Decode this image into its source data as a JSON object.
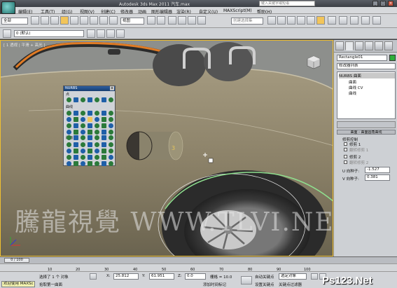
{
  "titlebar": {
    "title": "Autodesk 3ds Max  2011      汽车.max",
    "search_placeholder": "键入关键字或短语",
    "min_label": "_",
    "max_label": "□",
    "close_label": "×"
  },
  "menu": [
    "编辑(E)",
    "工具(T)",
    "组(G)",
    "视图(V)",
    "创建(C)",
    "修改器",
    "动画",
    "图形编辑器",
    "渲染(R)",
    "自定义(U)",
    "MAXScript(M)",
    "帮助(H)"
  ],
  "toolbar": {
    "selection_filter": "全部",
    "ref_coord": "视图",
    "named_selection": "创建选择集"
  },
  "layer_toolbar": {
    "layer_dropdown": "0 (默认)"
  },
  "viewport": {
    "label": "[ 1 透视 | 平滑 + 高光 ]",
    "watermark": "騰龍視覺 WWW.TLVI.NET"
  },
  "palette": {
    "title": "NURBS",
    "close": "x",
    "section_points": "点",
    "section_curves": "曲线",
    "section_surfaces": "曲面"
  },
  "command_panel": {
    "object_name": "Rectangle01",
    "modifier_list": "修改器列表",
    "stack": [
      "NURBS 曲面",
      "曲面",
      "曲线 CV",
      "曲线"
    ],
    "rollout_title": "曲面 - 曲面圆角曲线",
    "group_label": "修剪控制",
    "trim1": "修剪 1",
    "flip1": "翻转修剪 1",
    "trim2": "修剪 2",
    "flip2": "翻转修剪 2",
    "u_seed_label": "U 向种子:",
    "u_seed": "-1.527",
    "v_seed_label": "V 向种子:",
    "v_seed": "0.381"
  },
  "timeline": {
    "frame": "0 / 100",
    "ticks": [
      "10",
      "20",
      "30",
      "40",
      "50",
      "60",
      "70",
      "80",
      "90",
      "100"
    ]
  },
  "status": {
    "selection": "选择了 1 个 对象",
    "prompt": "拾取第一曲面",
    "maxscript": "欢迎使用 MAXSc",
    "x_label": "X:",
    "x_value": "25.812",
    "y_label": "Y:",
    "y_value": "61.951",
    "z_label": "Z:",
    "z_value": "0.0",
    "grid": "栅格 = 10.0",
    "add_tag": "添加时间标记",
    "auto_key": "自动关键点",
    "selected": "选定对象",
    "set_key": "设置关键点",
    "key_filter": "关键点过滤器"
  },
  "watermark_site": "Ps123.Net",
  "colors": {
    "accent": "#f2c55a",
    "title_bar": "#3b3f45",
    "panel_bg": "#cdd0d4",
    "viewport_bg": "#8d8f8c",
    "active_border": "#f0c030",
    "palette_header": "#2d5fa0"
  },
  "icons": [
    "app-logo-icon",
    "undo-icon",
    "redo-icon",
    "select-icon",
    "move-icon",
    "rotate-icon",
    "scale-icon",
    "snap-icon",
    "render-icon",
    "viewcube-icon",
    "play-icon",
    "key-icon"
  ]
}
